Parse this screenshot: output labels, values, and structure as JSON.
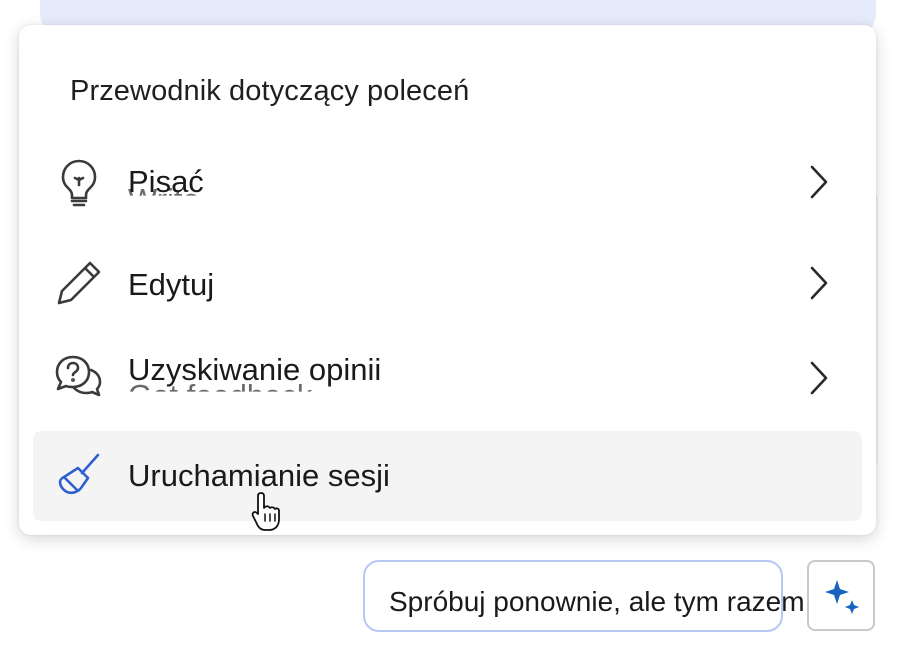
{
  "menu": {
    "title": "Przewodnik dotyczący poleceń",
    "items": [
      {
        "label": "Pisać",
        "ghost": "Write",
        "icon": "lightbulb-icon",
        "has_submenu": true
      },
      {
        "label": "Edytuj",
        "ghost": "",
        "icon": "pencil-icon",
        "has_submenu": true
      },
      {
        "label": "Uzyskiwanie opinii",
        "ghost": "Get feedback",
        "icon": "question-chat-icon",
        "has_submenu": true
      },
      {
        "label": "Uruchamianie sesji",
        "ghost": "",
        "icon": "broom-icon",
        "has_submenu": false,
        "hovered": true
      }
    ]
  },
  "suggestion": {
    "label": "Spróbuj ponownie, ale tym razem..."
  },
  "colors": {
    "accent": "#2f5fd0",
    "sparkle": "#1565c0",
    "hover_bg": "#f4f4f4",
    "suggestion_border": "#b6c8f2"
  }
}
